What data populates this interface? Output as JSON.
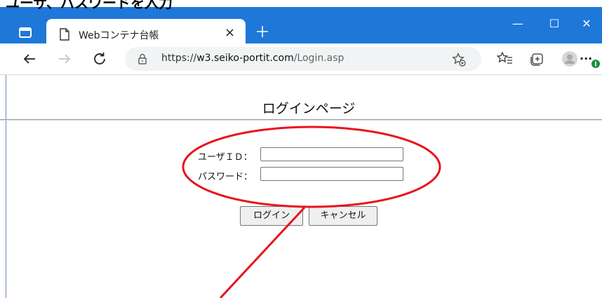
{
  "caption": "ユーザ、パスワードを入力",
  "browser": {
    "tab_title": "Webコンテナ台帳",
    "tab_close": "×",
    "window_controls": {
      "minimize": "—",
      "maximize": "☐",
      "close": "✕"
    },
    "url": {
      "scheme": "https://",
      "domain": "w3.seiko-portit.com",
      "path": "/Login.asp"
    },
    "more_icon": "···"
  },
  "page": {
    "title": "ログインページ",
    "form": {
      "user_id_label": "ユーザＩＤ：",
      "user_id_value": "",
      "password_label": "パスワード：",
      "password_value": ""
    },
    "buttons": {
      "login": "ログイン",
      "cancel": "キャンセル"
    }
  },
  "colors": {
    "titlebar": "#1e78d8",
    "annotation": "#e8141c"
  }
}
